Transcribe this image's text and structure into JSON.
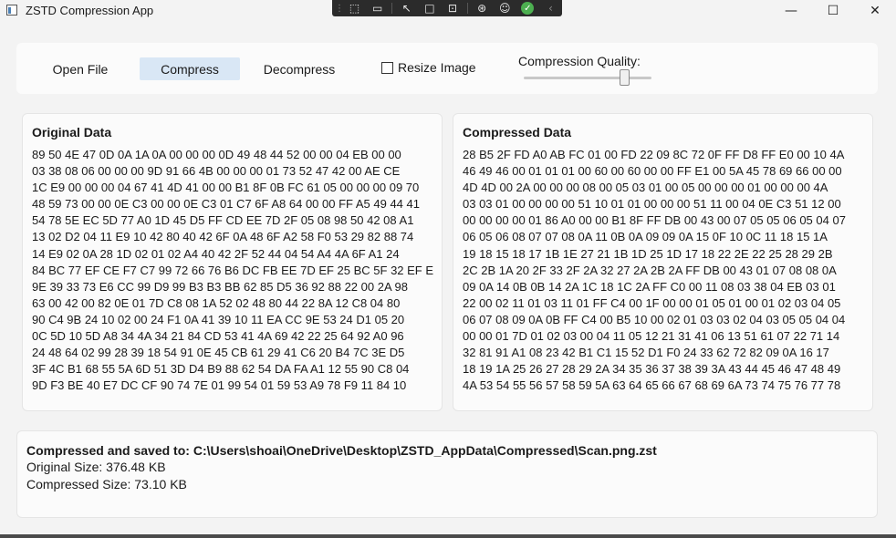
{
  "window": {
    "title": "ZSTD Compression App",
    "minimize": "—",
    "maximize": "☐",
    "close": "✕"
  },
  "overlay_toolbar": {
    "icons": [
      "drag-handle-icon",
      "select-region-icon",
      "record-video-icon",
      "pointer-icon",
      "window-capture-icon",
      "crop-icon",
      "ai-icon",
      "accessibility-icon",
      "confirm-icon",
      "collapse-icon"
    ]
  },
  "toolbar": {
    "open_file": "Open File",
    "compress": "Compress",
    "decompress": "Decompress",
    "resize_label": "Resize Image",
    "resize_checked": false,
    "quality_label": "Compression Quality:",
    "quality_fraction": 0.79
  },
  "original": {
    "title": "Original Data",
    "lines": [
      "89 50 4E 47 0D 0A 1A 0A 00 00 00 0D 49 48 44 52 00 00 04 EB 00 00",
      "03 38 08 06 00 00 00 9D 91 66 4B 00 00 00 01 73 52 47 42 00 AE CE",
      "1C E9 00 00 00 04 67 41 4D 41 00 00 B1 8F 0B FC 61 05 00 00 00 09 70",
      "48 59 73 00 00 0E C3 00 00 0E C3 01 C7 6F A8 64 00 00 FF A5 49 44 41",
      "54 78 5E EC 5D 77 A0 1D 45 D5 FF CD EE 7D 2F 05 08 98 50 42 08 A1",
      "13 02 D2 04 11 E9 10 42 80 40 42 6F 0A 48 6F A2 58 F0 53 29 82 88 74",
      "14 E9 02 0A 28 1D 02 01 02 A4 40 42 2F 52 44 04 54 A4 4A 6F A1 24",
      "84 BC 77 EF CE F7 C7 99 72 66 76 B6 DC FB EE 7D EF 25 BC 5F 32 EF EE",
      "9E 39 33 73 E6 CC 99 D9 99 B3 B3 BB 62 85 D5 36 92 88 22 00 2A 98",
      "63 00 42 00 82 0E 01 7D C8 08 1A 52 02 48 80 44 22 8A 12 C8 04 80",
      "90 C4 9B 24 10 02 00 24 F1 0A 41 39 10 11 EA CC 9E 53 24 D1 05 20",
      "0C 5D 10 5D A8 34 4A 34 21 84 CD 53 41 4A 69 42 22 25 64 92 A0 96",
      "24 48 64 02 99 28 39 18 54 91 0E 45 CB 61 29 41 C6 20 B4 7C 3E D5",
      "3F 4C B1 68 55 5A 6D 51 3D D4 B9 88 62 54 DA FA A1 12 55 90 C8 04",
      "9D F3 BE 40 E7 DC CF 90 74 7E 01 99 54 01 59 53 A9 78 F9 11 84 10"
    ]
  },
  "compressed": {
    "title": "Compressed Data",
    "lines": [
      "28 B5 2F FD A0 AB FC 01 00 FD 22 09 8C 72 0F FF D8 FF E0 00 10 4A",
      "46 49 46 00 01 01 01 00 60 00 60 00 00 FF E1 00 5A 45 78 69 66 00 00",
      "4D 4D 00 2A 00 00 00 08 00 05 03 01 00 05 00 00 00 01 00 00 00 4A",
      "03 03 01 00 00 00 00 51 10 01 01 00 00 00 51 11 00 04 0E C3 51 12 00",
      "00 00 00 00 01 86 A0 00 00 B1 8F FF DB 00 43 00 07 05 05 06 05 04 07",
      "06 05 06 08 07 07 08 0A 11 0B 0A 09 09 0A 15 0F 10 0C 11 18 15 1A",
      "19 18 15 18 17 1B 1E 27 21 1B 1D 25 1D 17 18 22 2E 22 25 28 29 2B",
      "2C 2B 1A 20 2F 33 2F 2A 32 27 2A 2B 2A FF DB 00 43 01 07 08 08 0A",
      "09 0A 14 0B 0B 14 2A 1C 18 1C 2A FF C0 00 11 08 03 38 04 EB 03 01",
      "22 00 02 11 01 03 11 01 FF C4 00 1F 00 00 01 05 01 00 01 02 03 04 05",
      "06 07 08 09 0A 0B FF C4 00 B5 10 00 02 01 03 03 02 04 03 05 05 04 04",
      "00 00 01 7D 01 02 03 00 04 11 05 12 21 31 41 06 13 51 61 07 22 71 14",
      "32 81 91 A1 08 23 42 B1 C1 15 52 D1 F0 24 33 62 72 82 09 0A 16 17",
      "18 19 1A 25 26 27 28 29 2A 34 35 36 37 38 39 3A 43 44 45 46 47 48 49",
      "4A 53 54 55 56 57 58 59 5A 63 64 65 66 67 68 69 6A 73 74 75 76 77 78"
    ]
  },
  "status": {
    "saved": "Compressed and saved to: C:\\Users\\shoai\\OneDrive\\Desktop\\ZSTD_AppData\\Compressed\\Scan.png.zst",
    "original_size": "Original Size: 376.48 KB",
    "compressed_size": "Compressed Size: 73.10 KB"
  }
}
